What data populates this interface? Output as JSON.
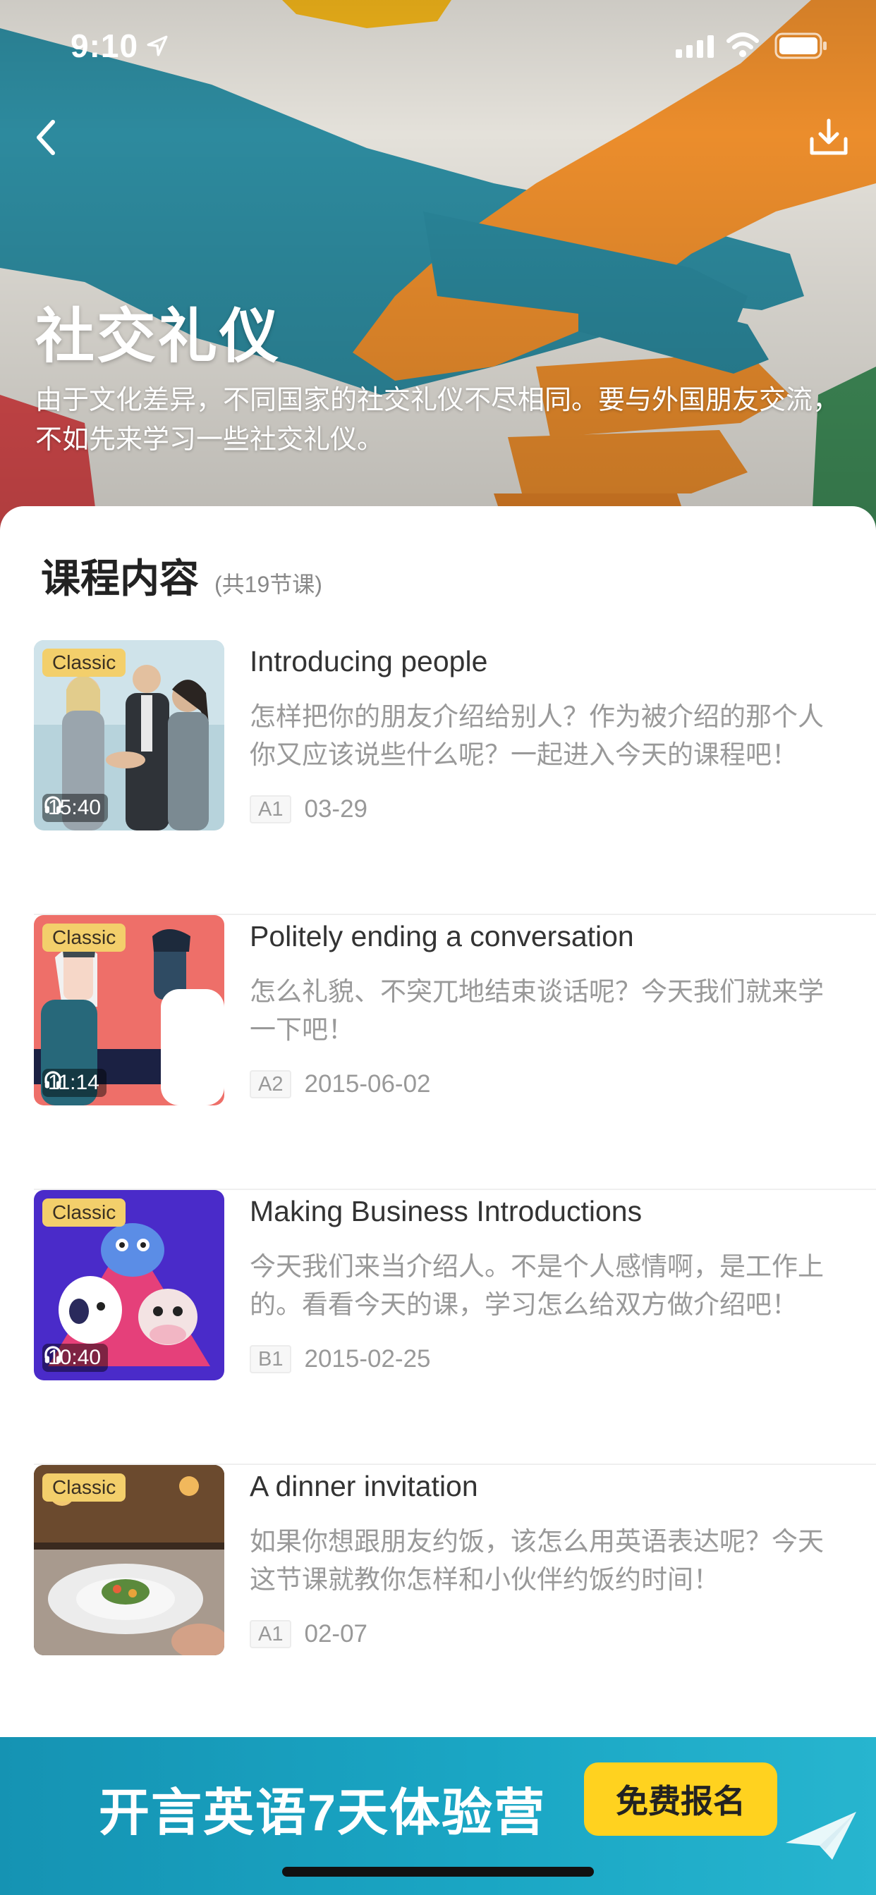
{
  "status_bar": {
    "time": "9:10"
  },
  "header": {
    "title": "社交礼仪",
    "description": "由于文化差异，不同国家的社交礼仪不尽相同。要与外国朋友交流，不如先来学习一些社交礼仪。"
  },
  "section": {
    "title": "课程内容",
    "count": "(共19节课)"
  },
  "lessons": [
    {
      "tag": "Classic",
      "duration": "15:40",
      "title": "Introducing people",
      "description": "怎样把你的朋友介绍给别人？作为被介绍的那个人你又应该说些什么呢？一起进入今天的课程吧！",
      "level": "A1",
      "date": "03-29"
    },
    {
      "tag": "Classic",
      "duration": "11:14",
      "title": "Politely ending a conversation",
      "description": "怎么礼貌、不突兀地结束谈话呢？今天我们就来学一下吧！",
      "level": "A2",
      "date": "2015-06-02"
    },
    {
      "tag": "Classic",
      "duration": "10:40",
      "title": "Making Business Introductions",
      "description": "今天我们来当介绍人。不是个人感情啊，是工作上的。看看今天的课，学习怎么给双方做介绍吧！",
      "level": "B1",
      "date": "2015-02-25"
    },
    {
      "tag": "Classic",
      "duration": "",
      "title": "A dinner invitation",
      "description": "如果你想跟朋友约饭，该怎么用英语表达呢？今天这节课就教你怎样和小伙伴约饭约时间！",
      "level": "A1",
      "date": "02-07"
    }
  ],
  "banner": {
    "text": "开言英语7天体验营",
    "button": "免费报名"
  },
  "colors": {
    "accent_yellow": "#ffd21f",
    "banner_blue": "#1aa6c4",
    "tag_gold": "#f3cf6b"
  },
  "icons": [
    "location-arrow-icon",
    "cellular-signal-icon",
    "wifi-icon",
    "battery-icon",
    "back-arrow-icon",
    "download-icon",
    "headphones-icon",
    "paper-plane-icon"
  ]
}
